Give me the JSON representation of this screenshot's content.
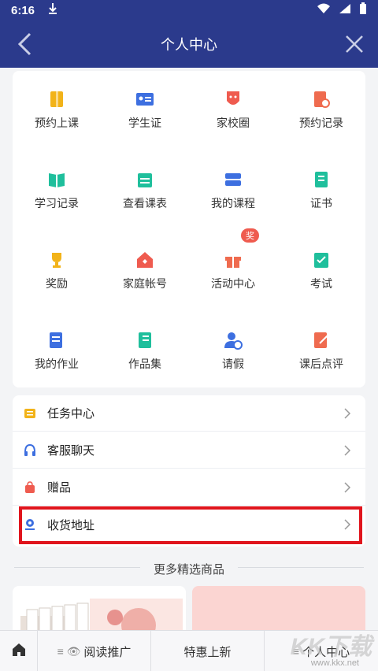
{
  "status": {
    "time": "6:16"
  },
  "header": {
    "title": "个人中心"
  },
  "grid": [
    {
      "label": "预约上课",
      "icon": "book-icon",
      "color": "#f2b319"
    },
    {
      "label": "学生证",
      "icon": "id-card-icon",
      "color": "#3d6fe0"
    },
    {
      "label": "家校圈",
      "icon": "badge-icon",
      "color": "#ef5b4f"
    },
    {
      "label": "预约记录",
      "icon": "record-icon",
      "color": "#ef6b4f"
    },
    {
      "label": "学习记录",
      "icon": "open-book-icon",
      "color": "#1fbf9c"
    },
    {
      "label": "查看课表",
      "icon": "calendar-icon",
      "color": "#1fbf9c"
    },
    {
      "label": "我的课程",
      "icon": "course-icon",
      "color": "#3d6fe0"
    },
    {
      "label": "证书",
      "icon": "certificate-icon",
      "color": "#1fbf9c"
    },
    {
      "label": "奖励",
      "icon": "trophy-icon",
      "color": "#f2b319"
    },
    {
      "label": "家庭帐号",
      "icon": "home-icon",
      "color": "#ef5b4f"
    },
    {
      "label": "活动中心",
      "icon": "gift-icon",
      "color": "#ef6b4f"
    },
    {
      "label": "考试",
      "icon": "clipboard-icon",
      "color": "#1fbf9c"
    },
    {
      "label": "我的作业",
      "icon": "homework-icon",
      "color": "#3d6fe0"
    },
    {
      "label": "作品集",
      "icon": "portfolio-icon",
      "color": "#1fbf9c"
    },
    {
      "label": "请假",
      "icon": "person-clock-icon",
      "color": "#3d6fe0"
    },
    {
      "label": "课后点评",
      "icon": "comment-edit-icon",
      "color": "#ef6b4f"
    }
  ],
  "badge": "奖",
  "list": [
    {
      "label": "任务中心",
      "icon": "task-icon",
      "color": "#f2b319"
    },
    {
      "label": "客服聊天",
      "icon": "headset-icon",
      "color": "#3d6fe0"
    },
    {
      "label": "赠品",
      "icon": "bag-icon",
      "color": "#ef5b4f"
    },
    {
      "label": "收货地址",
      "icon": "location-icon",
      "color": "#3d6fe0"
    }
  ],
  "section_title": "更多精选商品",
  "bottom_nav": [
    {
      "label": "",
      "icon": "home-icon"
    },
    {
      "label": "阅读推广",
      "prefix": "≡ 👁"
    },
    {
      "label": "特惠上新",
      "prefix": ""
    },
    {
      "label": "个人中心",
      "prefix": "≡"
    }
  ],
  "watermark": "KK下载",
  "watermark_url": "www.kkx.net"
}
